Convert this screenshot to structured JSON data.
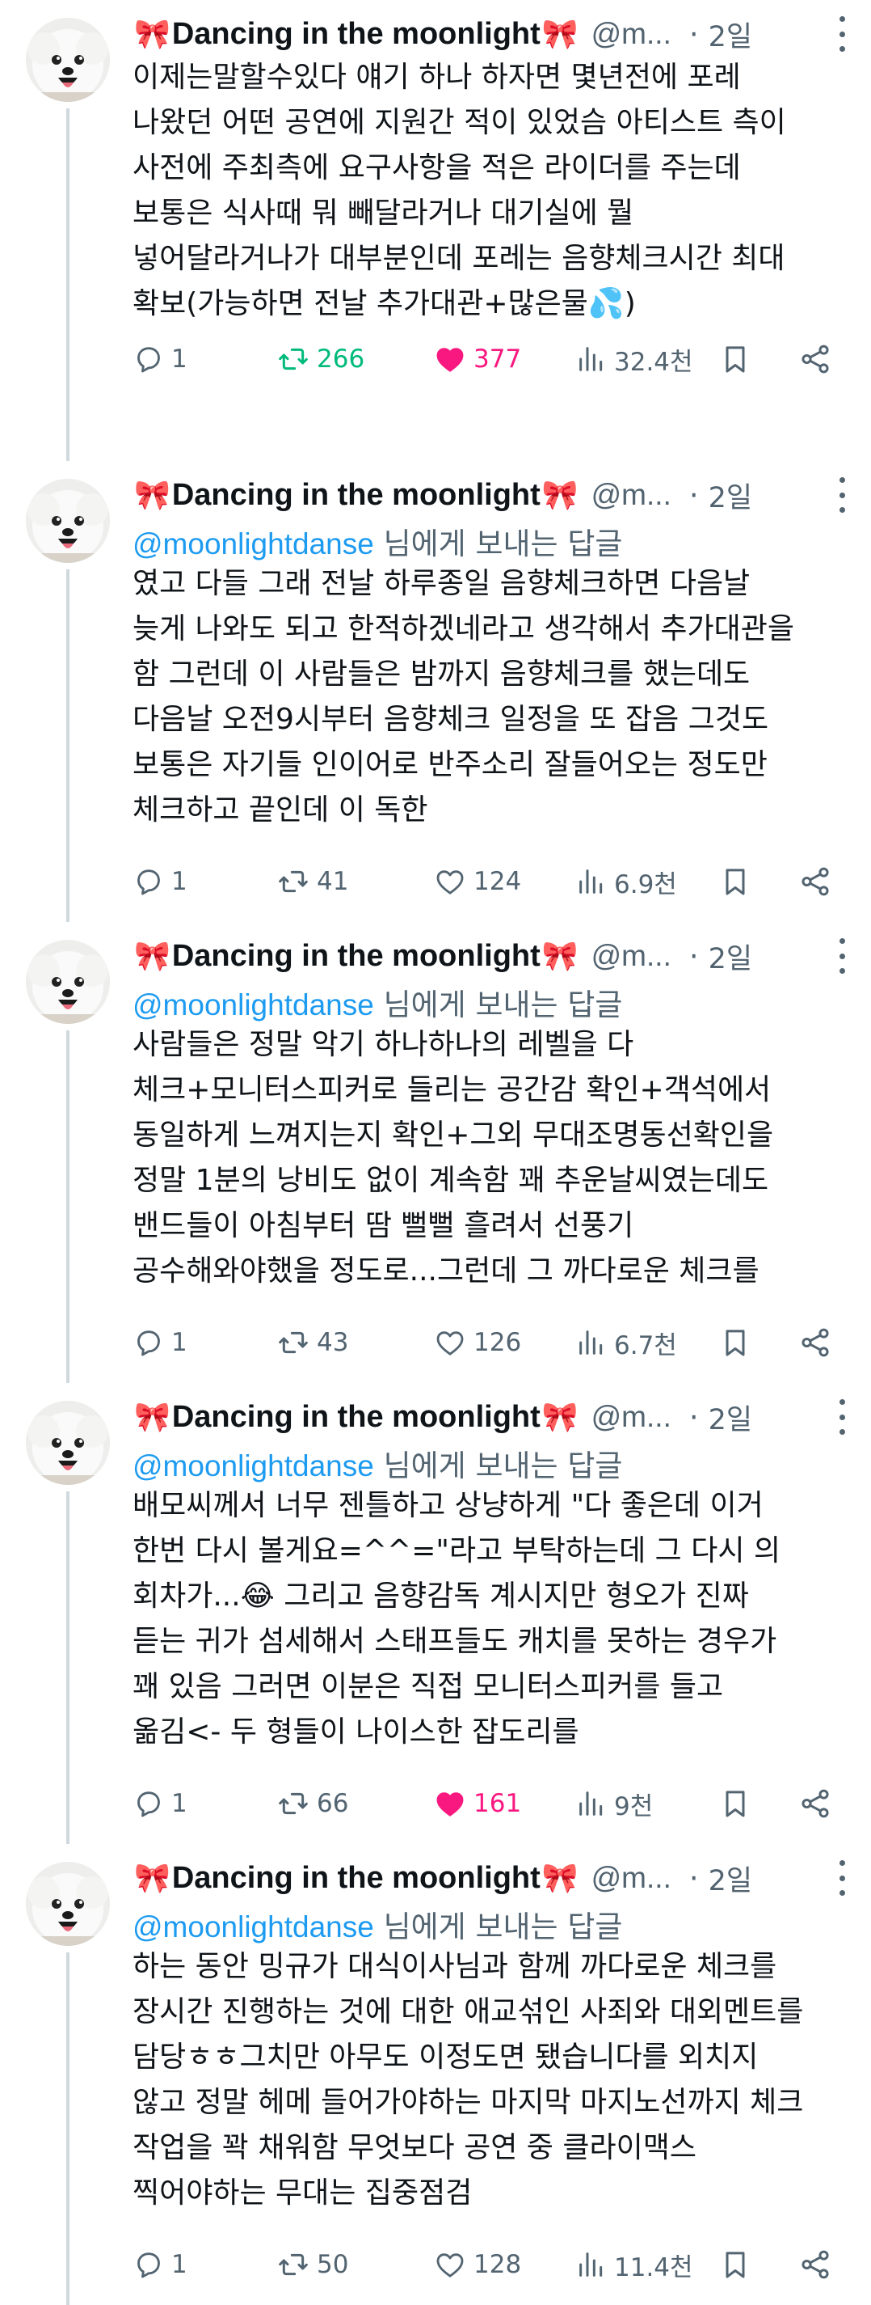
{
  "theme": {
    "text": "#0f1419",
    "muted": "#536471",
    "link": "#1d9bf0",
    "retweet_active": "#00ba7c",
    "like_active": "#f91880",
    "thread_line": "#cfd9de"
  },
  "tweets": [
    {
      "author": "Dancing in the moonlight",
      "handle": "@m...",
      "time": "2일",
      "reply_prefix": "",
      "reply_handle": "",
      "reply_suffix": "",
      "lines": [
        "이제는말할수있다 얘기 하나 하자면 몇년전에 포레",
        "나왔던 어떤 공연에 지원간 적이 있었슴 아티스트 측이",
        "사전에 주최측에 요구사항을 적은 라이더를 주는데",
        "보통은 식사때 뭐 빼달라거나 대기실에 뭘",
        "넣어달라거나가 대부분인데 포레는 음향체크시간 최대",
        "확보(가능하면 전날 추가대관+많은물💦)"
      ],
      "replies": "1",
      "retweets": "266",
      "likes": "377",
      "views": "32.4천",
      "retweeted": true,
      "liked": true
    },
    {
      "author": "Dancing in the moonlight",
      "handle": "@m...",
      "time": "2일",
      "reply_handle": "@moonlightdanse",
      "reply_suffix": " 님에게 보내는 답글",
      "lines": [
        "였고 다들 그래 전날 하루종일 음향체크하면 다음날",
        "늦게 나와도 되고 한적하겠네라고 생각해서 추가대관을",
        "함 그런데 이 사람들은 밤까지 음향체크를 했는데도",
        "다음날 오전9시부터 음향체크 일정을 또 잡음 그것도",
        "보통은 자기들 인이어로 반주소리 잘들어오는 정도만",
        "체크하고 끝인데 이 독한"
      ],
      "replies": "1",
      "retweets": "41",
      "likes": "124",
      "views": "6.9천",
      "retweeted": false,
      "liked": false
    },
    {
      "author": "Dancing in the moonlight",
      "handle": "@m...",
      "time": "2일",
      "reply_handle": "@moonlightdanse",
      "reply_suffix": " 님에게 보내는 답글",
      "lines": [
        "사람들은 정말 악기 하나하나의 레벨을 다",
        "체크+모니터스피커로 들리는 공간감 확인+객석에서",
        "동일하게 느껴지는지 확인+그외 무대조명동선확인을",
        "정말 1분의 낭비도 없이 계속함 꽤 추운날씨였는데도",
        "밴드들이 아침부터 땀 뻘뻘 흘려서 선풍기",
        "공수해와야했을 정도로...그런데 그 까다로운 체크를"
      ],
      "replies": "1",
      "retweets": "43",
      "likes": "126",
      "views": "6.7천",
      "retweeted": false,
      "liked": false
    },
    {
      "author": "Dancing in the moonlight",
      "handle": "@m...",
      "time": "2일",
      "reply_handle": "@moonlightdanse",
      "reply_suffix": " 님에게 보내는 답글",
      "lines": [
        "배모씨께서 너무 젠틀하고 상냥하게 \"다 좋은데 이거",
        "한번 다시 볼게요=^^=\"라고 부탁하는데 그 다시 의",
        "회차가...😂 그리고 음향감독 계시지만 형오가 진짜",
        "듣는 귀가 섬세해서 스태프들도 캐치를 못하는 경우가",
        "꽤 있음 그러면 이분은 직접 모니터스피커를 들고",
        "옮김<- 두 형들이 나이스한 잡도리를"
      ],
      "replies": "1",
      "retweets": "66",
      "likes": "161",
      "views": "9천",
      "retweeted": false,
      "liked": true
    },
    {
      "author": "Dancing in the moonlight",
      "handle": "@m...",
      "time": "2일",
      "reply_handle": "@moonlightdanse",
      "reply_suffix": " 님에게 보내는 답글",
      "lines": [
        "하는 동안 밍규가 대식이사님과 함께 까다로운 체크를",
        "장시간 진행하는 것에 대한 애교섞인 사죄와 대외멘트를",
        "담당ㅎㅎ그치만 아무도 이정도면 됐습니다를 외치지",
        "않고 정말 헤메 들어가야하는 마지막 마지노선까지 체크",
        "작업을 꽉 채워함 무엇보다 공연 중 클라이맥스",
        "찍어야하는 무대는 집중점검"
      ],
      "replies": "1",
      "retweets": "50",
      "likes": "128",
      "views": "11.4천",
      "retweeted": false,
      "liked": false
    }
  ]
}
